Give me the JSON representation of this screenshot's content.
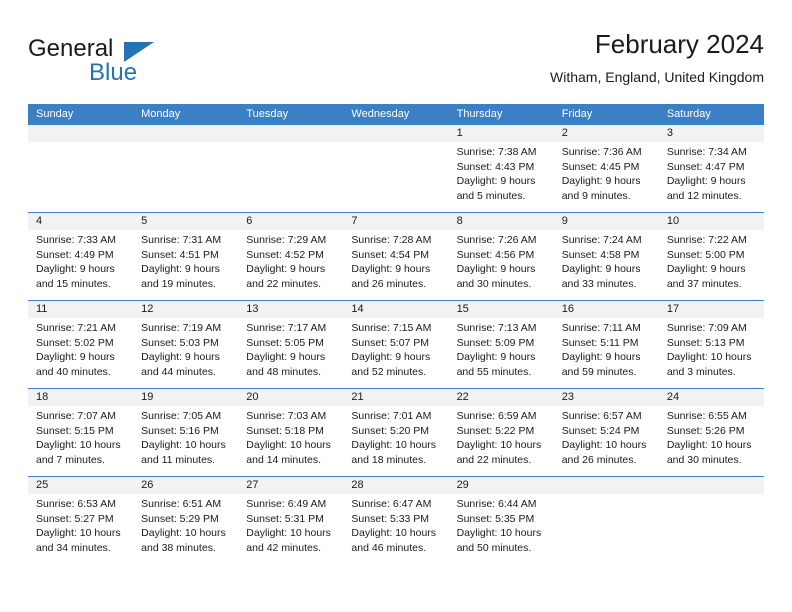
{
  "brand": {
    "name_top": "General",
    "name_bottom": "Blue",
    "triangle_color": "#2572b5",
    "accent_color": "#2572b5"
  },
  "header": {
    "title": "February 2024",
    "subtitle": "Witham, England, United Kingdom"
  },
  "calendar": {
    "header_bg": "#3b7fc4",
    "daynum_bg": "#f2f2f2",
    "weekdays": [
      "Sunday",
      "Monday",
      "Tuesday",
      "Wednesday",
      "Thursday",
      "Friday",
      "Saturday"
    ],
    "weeks": [
      [
        {
          "day": "",
          "sunrise": "",
          "sunset": "",
          "daylight_1": "",
          "daylight_2": ""
        },
        {
          "day": "",
          "sunrise": "",
          "sunset": "",
          "daylight_1": "",
          "daylight_2": ""
        },
        {
          "day": "",
          "sunrise": "",
          "sunset": "",
          "daylight_1": "",
          "daylight_2": ""
        },
        {
          "day": "",
          "sunrise": "",
          "sunset": "",
          "daylight_1": "",
          "daylight_2": ""
        },
        {
          "day": "1",
          "sunrise": "Sunrise: 7:38 AM",
          "sunset": "Sunset: 4:43 PM",
          "daylight_1": "Daylight: 9 hours",
          "daylight_2": "and 5 minutes."
        },
        {
          "day": "2",
          "sunrise": "Sunrise: 7:36 AM",
          "sunset": "Sunset: 4:45 PM",
          "daylight_1": "Daylight: 9 hours",
          "daylight_2": "and 9 minutes."
        },
        {
          "day": "3",
          "sunrise": "Sunrise: 7:34 AM",
          "sunset": "Sunset: 4:47 PM",
          "daylight_1": "Daylight: 9 hours",
          "daylight_2": "and 12 minutes."
        }
      ],
      [
        {
          "day": "4",
          "sunrise": "Sunrise: 7:33 AM",
          "sunset": "Sunset: 4:49 PM",
          "daylight_1": "Daylight: 9 hours",
          "daylight_2": "and 15 minutes."
        },
        {
          "day": "5",
          "sunrise": "Sunrise: 7:31 AM",
          "sunset": "Sunset: 4:51 PM",
          "daylight_1": "Daylight: 9 hours",
          "daylight_2": "and 19 minutes."
        },
        {
          "day": "6",
          "sunrise": "Sunrise: 7:29 AM",
          "sunset": "Sunset: 4:52 PM",
          "daylight_1": "Daylight: 9 hours",
          "daylight_2": "and 22 minutes."
        },
        {
          "day": "7",
          "sunrise": "Sunrise: 7:28 AM",
          "sunset": "Sunset: 4:54 PM",
          "daylight_1": "Daylight: 9 hours",
          "daylight_2": "and 26 minutes."
        },
        {
          "day": "8",
          "sunrise": "Sunrise: 7:26 AM",
          "sunset": "Sunset: 4:56 PM",
          "daylight_1": "Daylight: 9 hours",
          "daylight_2": "and 30 minutes."
        },
        {
          "day": "9",
          "sunrise": "Sunrise: 7:24 AM",
          "sunset": "Sunset: 4:58 PM",
          "daylight_1": "Daylight: 9 hours",
          "daylight_2": "and 33 minutes."
        },
        {
          "day": "10",
          "sunrise": "Sunrise: 7:22 AM",
          "sunset": "Sunset: 5:00 PM",
          "daylight_1": "Daylight: 9 hours",
          "daylight_2": "and 37 minutes."
        }
      ],
      [
        {
          "day": "11",
          "sunrise": "Sunrise: 7:21 AM",
          "sunset": "Sunset: 5:02 PM",
          "daylight_1": "Daylight: 9 hours",
          "daylight_2": "and 40 minutes."
        },
        {
          "day": "12",
          "sunrise": "Sunrise: 7:19 AM",
          "sunset": "Sunset: 5:03 PM",
          "daylight_1": "Daylight: 9 hours",
          "daylight_2": "and 44 minutes."
        },
        {
          "day": "13",
          "sunrise": "Sunrise: 7:17 AM",
          "sunset": "Sunset: 5:05 PM",
          "daylight_1": "Daylight: 9 hours",
          "daylight_2": "and 48 minutes."
        },
        {
          "day": "14",
          "sunrise": "Sunrise: 7:15 AM",
          "sunset": "Sunset: 5:07 PM",
          "daylight_1": "Daylight: 9 hours",
          "daylight_2": "and 52 minutes."
        },
        {
          "day": "15",
          "sunrise": "Sunrise: 7:13 AM",
          "sunset": "Sunset: 5:09 PM",
          "daylight_1": "Daylight: 9 hours",
          "daylight_2": "and 55 minutes."
        },
        {
          "day": "16",
          "sunrise": "Sunrise: 7:11 AM",
          "sunset": "Sunset: 5:11 PM",
          "daylight_1": "Daylight: 9 hours",
          "daylight_2": "and 59 minutes."
        },
        {
          "day": "17",
          "sunrise": "Sunrise: 7:09 AM",
          "sunset": "Sunset: 5:13 PM",
          "daylight_1": "Daylight: 10 hours",
          "daylight_2": "and 3 minutes."
        }
      ],
      [
        {
          "day": "18",
          "sunrise": "Sunrise: 7:07 AM",
          "sunset": "Sunset: 5:15 PM",
          "daylight_1": "Daylight: 10 hours",
          "daylight_2": "and 7 minutes."
        },
        {
          "day": "19",
          "sunrise": "Sunrise: 7:05 AM",
          "sunset": "Sunset: 5:16 PM",
          "daylight_1": "Daylight: 10 hours",
          "daylight_2": "and 11 minutes."
        },
        {
          "day": "20",
          "sunrise": "Sunrise: 7:03 AM",
          "sunset": "Sunset: 5:18 PM",
          "daylight_1": "Daylight: 10 hours",
          "daylight_2": "and 14 minutes."
        },
        {
          "day": "21",
          "sunrise": "Sunrise: 7:01 AM",
          "sunset": "Sunset: 5:20 PM",
          "daylight_1": "Daylight: 10 hours",
          "daylight_2": "and 18 minutes."
        },
        {
          "day": "22",
          "sunrise": "Sunrise: 6:59 AM",
          "sunset": "Sunset: 5:22 PM",
          "daylight_1": "Daylight: 10 hours",
          "daylight_2": "and 22 minutes."
        },
        {
          "day": "23",
          "sunrise": "Sunrise: 6:57 AM",
          "sunset": "Sunset: 5:24 PM",
          "daylight_1": "Daylight: 10 hours",
          "daylight_2": "and 26 minutes."
        },
        {
          "day": "24",
          "sunrise": "Sunrise: 6:55 AM",
          "sunset": "Sunset: 5:26 PM",
          "daylight_1": "Daylight: 10 hours",
          "daylight_2": "and 30 minutes."
        }
      ],
      [
        {
          "day": "25",
          "sunrise": "Sunrise: 6:53 AM",
          "sunset": "Sunset: 5:27 PM",
          "daylight_1": "Daylight: 10 hours",
          "daylight_2": "and 34 minutes."
        },
        {
          "day": "26",
          "sunrise": "Sunrise: 6:51 AM",
          "sunset": "Sunset: 5:29 PM",
          "daylight_1": "Daylight: 10 hours",
          "daylight_2": "and 38 minutes."
        },
        {
          "day": "27",
          "sunrise": "Sunrise: 6:49 AM",
          "sunset": "Sunset: 5:31 PM",
          "daylight_1": "Daylight: 10 hours",
          "daylight_2": "and 42 minutes."
        },
        {
          "day": "28",
          "sunrise": "Sunrise: 6:47 AM",
          "sunset": "Sunset: 5:33 PM",
          "daylight_1": "Daylight: 10 hours",
          "daylight_2": "and 46 minutes."
        },
        {
          "day": "29",
          "sunrise": "Sunrise: 6:44 AM",
          "sunset": "Sunset: 5:35 PM",
          "daylight_1": "Daylight: 10 hours",
          "daylight_2": "and 50 minutes."
        },
        {
          "day": "",
          "sunrise": "",
          "sunset": "",
          "daylight_1": "",
          "daylight_2": ""
        },
        {
          "day": "",
          "sunrise": "",
          "sunset": "",
          "daylight_1": "",
          "daylight_2": ""
        }
      ]
    ]
  }
}
